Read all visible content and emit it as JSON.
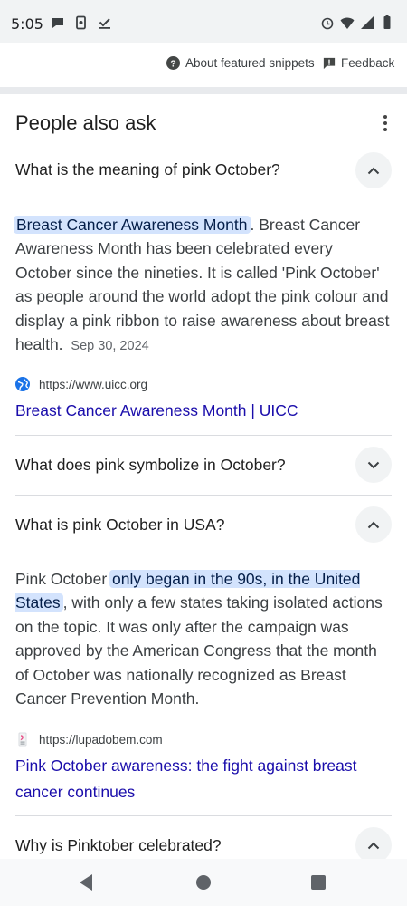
{
  "status_bar": {
    "time": "5:05",
    "left_icons": [
      "chat-bubble-icon",
      "phone-sync-icon",
      "checkmark-download-icon"
    ],
    "right_icons": [
      "alarm-icon",
      "wifi-icon",
      "cell-signal-icon",
      "battery-icon"
    ]
  },
  "snippet_footer": {
    "about_label": "About featured snippets",
    "feedback_label": "Feedback"
  },
  "paa": {
    "title": "People also ask",
    "questions": [
      {
        "question": "What is the meaning of pink October?",
        "expanded": true,
        "answer_highlight": "Breast Cancer Awareness Month",
        "answer_rest": ". Breast Cancer Awareness Month has been celebrated every October since the nineties. It is called 'Pink October' as people around the world adopt the pink colour and display a pink ribbon to raise awareness about breast health.",
        "date": "Sep 30, 2024",
        "source_url": "https://www.uicc.org",
        "source_title": "Breast Cancer Awareness Month | UICC"
      },
      {
        "question": "What does pink symbolize in October?",
        "expanded": false
      },
      {
        "question": "What is pink October in USA?",
        "expanded": true,
        "answer_pre": "Pink October ",
        "answer_highlight": "only began in the 90s, in the United States",
        "answer_rest": ", with only a few states taking isolated actions on the topic. It was only after the campaign was approved by the American Congress that the month of October was nationally recognized as Breast Cancer Prevention Month.",
        "source_url": "https://lupadobem.com",
        "source_title": "Pink October awareness: the fight against breast cancer continues"
      },
      {
        "question": "Why is Pinktober celebrated?",
        "expanded": true
      }
    ]
  },
  "nav_bar": {
    "icons": [
      "back-triangle-icon",
      "home-circle-icon",
      "recents-square-icon"
    ]
  },
  "colors": {
    "highlight": "#d3e3fd",
    "link": "#1a0dab",
    "chevron_bg": "#f1f3f4"
  }
}
